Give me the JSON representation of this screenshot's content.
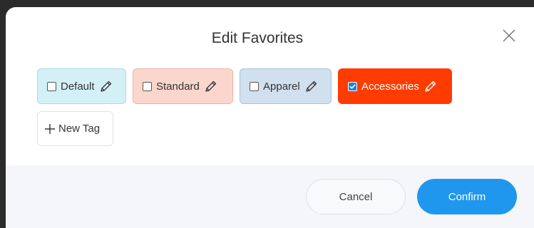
{
  "dialog": {
    "title": "Edit Favorites",
    "close_icon": "close-icon"
  },
  "tags": [
    {
      "label": "Default",
      "checked": false,
      "edit_icon": "pencil-icon"
    },
    {
      "label": "Standard",
      "checked": false,
      "edit_icon": "pencil-icon"
    },
    {
      "label": "Apparel",
      "checked": false,
      "edit_icon": "pencil-icon"
    },
    {
      "label": "Accessories",
      "checked": true,
      "edit_icon": "pencil-icon"
    }
  ],
  "new_tag": {
    "label": "New Tag",
    "icon": "plus-icon"
  },
  "footer": {
    "cancel_label": "Cancel",
    "confirm_label": "Confirm"
  },
  "colors": {
    "default_tag": "#d4f0f7",
    "standard_tag": "#fbd6cc",
    "apparel_tag": "#d0e0ee",
    "accessories_tag": "#ff3c00",
    "confirm_button": "#1f97ef"
  }
}
